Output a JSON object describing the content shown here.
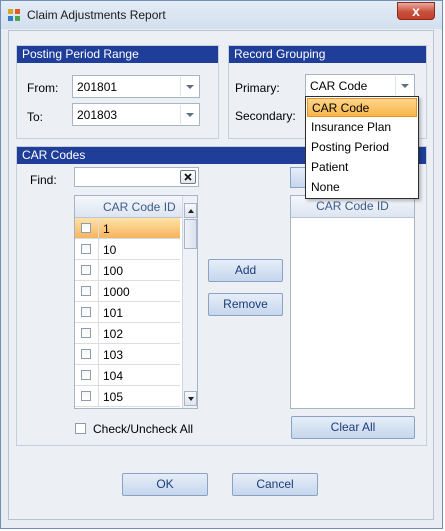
{
  "window": {
    "title": "Claim Adjustments Report",
    "close_glyph": "x"
  },
  "posting_period": {
    "header": "Posting Period Range",
    "from_label": "From:",
    "from_value": "201801",
    "to_label": "To:",
    "to_value": "201803"
  },
  "record_grouping": {
    "header": "Record Grouping",
    "primary_label": "Primary:",
    "primary_value": "CAR Code",
    "secondary_label": "Secondary:",
    "options": [
      "CAR Code",
      "Insurance Plan",
      "Posting Period",
      "Patient",
      "None"
    ]
  },
  "car_codes": {
    "header": "CAR Codes",
    "find_label": "Find:",
    "find_value": "",
    "column_header": "CAR Code ID",
    "rows": [
      "1",
      "10",
      "100",
      "1000",
      "101",
      "102",
      "103",
      "104",
      "105"
    ],
    "selected_row": "1",
    "add_label": "Add",
    "remove_label": "Remove",
    "right_column_header": "CAR Code ID",
    "check_all_label": "Check/Uncheck All",
    "clear_all_label": "Clear All"
  },
  "footer": {
    "ok_label": "OK",
    "cancel_label": "Cancel"
  },
  "colors": {
    "group_header": "#1f3e9a",
    "selection": "#f8b54a",
    "window_border": "#6f8fb3"
  },
  "icons": [
    "app-icon",
    "close-icon",
    "clear-x-icon",
    "chevron-down-icon",
    "scroll-up-icon",
    "scroll-down-icon"
  ]
}
